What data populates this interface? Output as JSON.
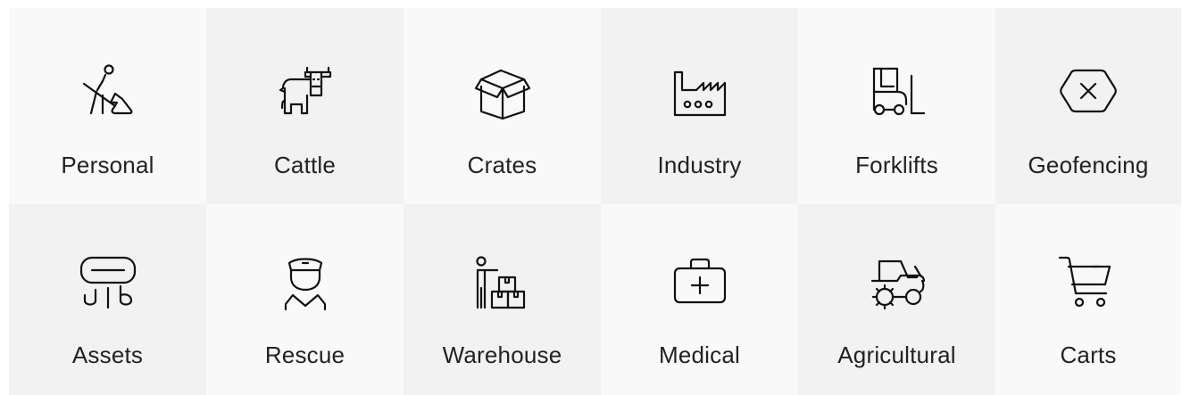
{
  "tiles": [
    {
      "label": "Personal",
      "icon": "person-digging-icon"
    },
    {
      "label": "Cattle",
      "icon": "cow-icon"
    },
    {
      "label": "Crates",
      "icon": "open-box-icon"
    },
    {
      "label": "Industry",
      "icon": "factory-icon"
    },
    {
      "label": "Forklifts",
      "icon": "forklift-icon"
    },
    {
      "label": "Geofencing",
      "icon": "hexagon-x-icon"
    },
    {
      "label": "Assets",
      "icon": "air-conditioner-icon"
    },
    {
      "label": "Rescue",
      "icon": "police-officer-icon"
    },
    {
      "label": "Warehouse",
      "icon": "person-with-boxes-icon"
    },
    {
      "label": "Medical",
      "icon": "medical-kit-icon"
    },
    {
      "label": "Agricultural",
      "icon": "tractor-icon"
    },
    {
      "label": "Carts",
      "icon": "shopping-cart-icon"
    }
  ],
  "colors": {
    "tile_light": "#f9f9f9",
    "tile_dark": "#f2f2f2",
    "icon": "#111111",
    "text": "#222222"
  }
}
